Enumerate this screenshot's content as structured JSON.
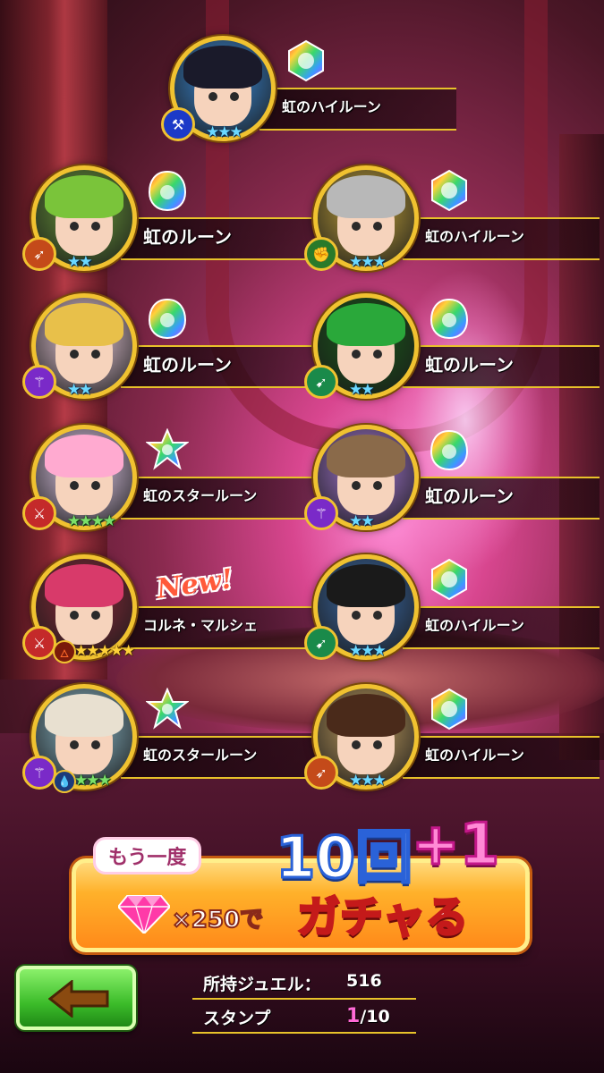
{
  "results": [
    {
      "reward": "虹のハイルーン",
      "rune": "hi",
      "role": "axe-icon",
      "stars": "★★★",
      "star_color": "blue",
      "portrait": {
        "hair": "#1a1a2a",
        "bg": "#3a8ad8"
      }
    },
    {
      "reward": "虹のルーン",
      "rune": "basic",
      "role": "bow-icon",
      "stars": "★★",
      "star_color": "blue",
      "portrait": {
        "hair": "#7ac43a",
        "bg": "#6a9a3a"
      }
    },
    {
      "reward": "虹のハイルーン",
      "rune": "hi",
      "role": "fist-icon",
      "stars": "★★★",
      "star_color": "blue",
      "portrait": {
        "hair": "#b8b8b8",
        "bg": "#c4a43a"
      }
    },
    {
      "reward": "虹のルーン",
      "rune": "basic",
      "role": "staff-icon",
      "stars": "★★",
      "star_color": "blue",
      "portrait": {
        "hair": "#e8c04a",
        "bg": "#f0d0e0"
      }
    },
    {
      "reward": "虹のルーン",
      "rune": "basic",
      "role": "spear-icon",
      "stars": "★★",
      "star_color": "blue",
      "portrait": {
        "hair": "#2aa83a",
        "bg": "#1a5a1a"
      }
    },
    {
      "reward": "虹のスタールーン",
      "rune": "star",
      "role": "sword-icon",
      "stars": "★★★★",
      "star_color": "green",
      "portrait": {
        "hair": "#ffaad0",
        "bg": "#e8d0f0"
      }
    },
    {
      "reward": "虹のルーン",
      "rune": "basic",
      "role": "staff-icon",
      "stars": "★★",
      "star_color": "blue",
      "portrait": {
        "hair": "#8a6a4a",
        "bg": "#a87ad8"
      }
    },
    {
      "reward": "コルネ・マルシェ",
      "rune": "none",
      "role": "sword-icon",
      "stars": "★★★★★",
      "star_color": "gold",
      "attr": "fire-icon",
      "portrait": {
        "hair": "#d83a6a",
        "bg": "#8a2a3a"
      }
    },
    {
      "reward": "虹のハイルーン",
      "rune": "hi",
      "role": "spear-icon",
      "stars": "★★★",
      "star_color": "blue",
      "portrait": {
        "hair": "#1a1a1a",
        "bg": "#3a6aa8"
      }
    },
    {
      "reward": "虹のスタールーン",
      "rune": "star",
      "role": "staff-icon",
      "stars": "★★★",
      "star_color": "green",
      "attr": "water-icon",
      "portrait": {
        "hair": "#e8e0d0",
        "bg": "#8ab8c8"
      }
    },
    {
      "reward": "虹のハイルーン",
      "rune": "hi",
      "role": "bow-icon",
      "stars": "★★★",
      "star_color": "blue",
      "portrait": {
        "hair": "#4a2a1a",
        "bg": "#c4a060"
      }
    }
  ],
  "new_badge": "New!",
  "gacha": {
    "again_label": "もう一度",
    "count_label": "10回",
    "plus_label": "+1",
    "cost_label": "×250で",
    "verb_label": "ガチャる"
  },
  "info": {
    "jewel_label": "所持ジュエル：",
    "jewel_value": "516",
    "stamp_label": "スタンプ",
    "stamp_current": "1",
    "stamp_total": "/10"
  },
  "back_button": "arrow-left-icon"
}
